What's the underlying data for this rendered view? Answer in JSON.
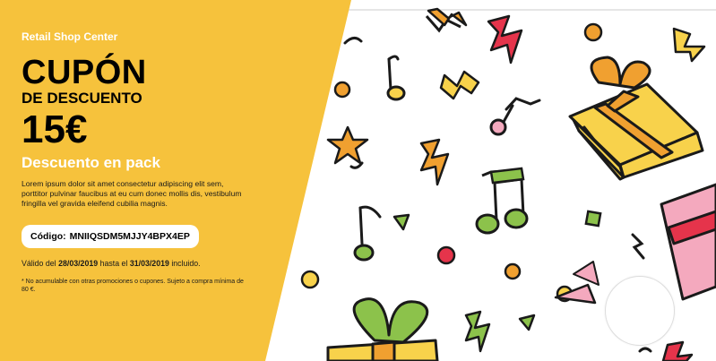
{
  "brand": "Retail Shop Center",
  "title_main": "CUPÓN",
  "title_sub": "DE DESCUENTO",
  "amount": "15€",
  "subtitle": "Descuento en pack",
  "description": "Lorem ipsum dolor sit amet consectetur adipiscing elit sem, porttitor pulvinar faucibus at eu cum donec mollis dis, vestibulum fringilla vel gravida eleifend cubilia magnis.",
  "code": {
    "label": "Código:",
    "value": "MNIIQSDM5MJJY4BPX4EP"
  },
  "validity": {
    "prefix": "Válido del",
    "start_date": "28/03/2019",
    "middle": "hasta el",
    "end_date": "31/03/2019",
    "suffix": "incluido."
  },
  "fine_print": "* No acumulable con otras promociones o cupones. Sujeto a compra mínima de 80 €.",
  "colors": {
    "panel_yellow": "#F6C23C",
    "gift_yellow": "#F8D24B",
    "ribbon_orange": "#F0A030",
    "pink": "#F4A9BE",
    "red": "#E5344B",
    "green": "#8CC24B",
    "outline": "#1a1a1a"
  },
  "icons": [
    "gift-icon",
    "music-note-icon",
    "lightning-icon",
    "star-icon",
    "circle-dot-icon",
    "triangle-icon"
  ]
}
